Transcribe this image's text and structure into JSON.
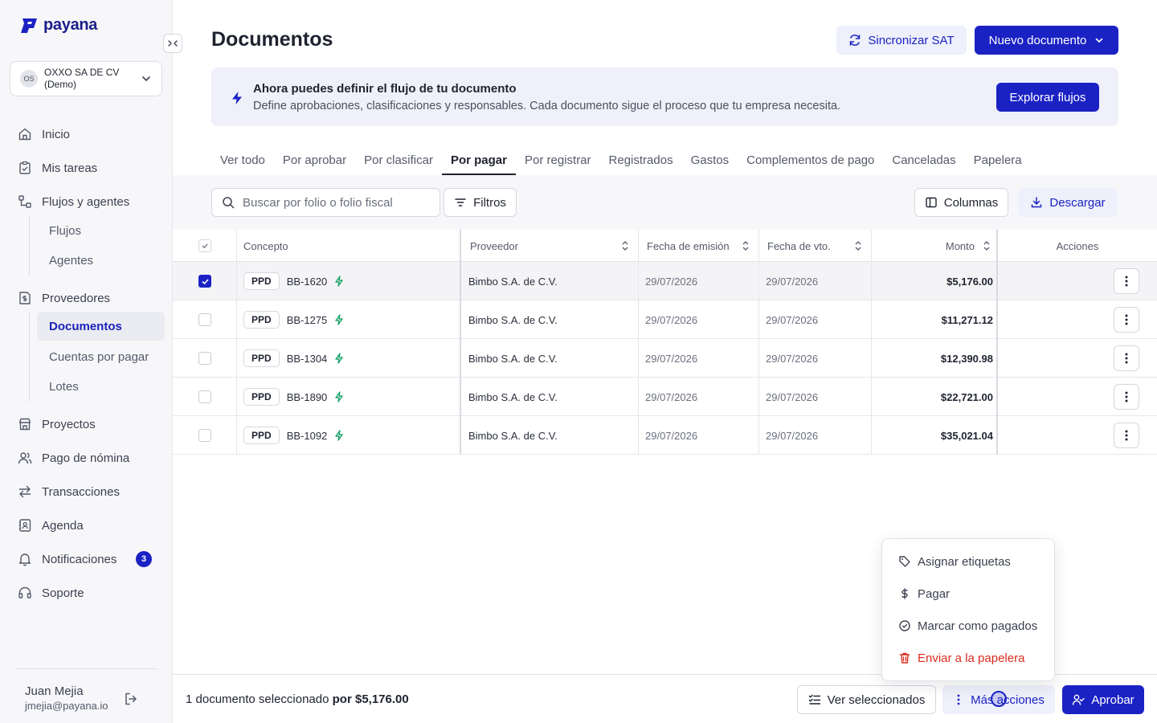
{
  "brand": {
    "name": "payana",
    "accent": "#1b22c4",
    "success": "#1aa36a",
    "danger": "#d92d20"
  },
  "company": {
    "initials": "OS",
    "name": "OXXO SA DE CV (Demo)"
  },
  "nav": {
    "inicio": "Inicio",
    "tareas": "Mis tareas",
    "flujos_agentes": "Flujos y agentes",
    "flujos": "Flujos",
    "agentes": "Agentes",
    "proveedores": "Proveedores",
    "documentos": "Documentos",
    "cuentas": "Cuentas por pagar",
    "lotes": "Lotes",
    "proyectos": "Proyectos",
    "nomina": "Pago de nómina",
    "transacciones": "Transacciones",
    "agenda": "Agenda",
    "notificaciones": "Notificaciones",
    "notificaciones_count": "3",
    "soporte": "Soporte"
  },
  "user": {
    "name": "Juan Mejia",
    "email": "jmejia@payana.io"
  },
  "page": {
    "title": "Documentos",
    "sync_label": "Sincronizar SAT",
    "new_label": "Nuevo documento"
  },
  "banner": {
    "title": "Ahora puedes definir el flujo de tu documento",
    "text": "Define aprobaciones, clasificaciones y responsables. Cada documento sigue el proceso que tu empresa necesita.",
    "button": "Explorar flujos"
  },
  "tabs": [
    "Ver todo",
    "Por aprobar",
    "Por clasificar",
    "Por pagar",
    "Por registrar",
    "Registrados",
    "Gastos",
    "Complementos de pago",
    "Canceladas",
    "Papelera"
  ],
  "active_tab": "Por pagar",
  "toolbar": {
    "search_placeholder": "Buscar por folio o folio fiscal",
    "filters": "Filtros",
    "columns": "Columnas",
    "download": "Descargar"
  },
  "table": {
    "headers": {
      "concepto": "Concepto",
      "proveedor": "Proveedor",
      "emision": "Fecha de emisión",
      "vto": "Fecha de vto.",
      "monto": "Monto",
      "acciones": "Acciones"
    },
    "rows": [
      {
        "tag": "PPD",
        "folio": "BB-1620",
        "proveedor": "Bimbo S.A. de C.V.",
        "emision": "29/07/2026",
        "vto": "29/07/2026",
        "monto": "$5,176.00",
        "selected": true
      },
      {
        "tag": "PPD",
        "folio": "BB-1275",
        "proveedor": "Bimbo S.A. de C.V.",
        "emision": "29/07/2026",
        "vto": "29/07/2026",
        "monto": "$11,271.12",
        "selected": false
      },
      {
        "tag": "PPD",
        "folio": "BB-1304",
        "proveedor": "Bimbo S.A. de C.V.",
        "emision": "29/07/2026",
        "vto": "29/07/2026",
        "monto": "$12,390.98",
        "selected": false
      },
      {
        "tag": "PPD",
        "folio": "BB-1890",
        "proveedor": "Bimbo S.A. de C.V.",
        "emision": "29/07/2026",
        "vto": "29/07/2026",
        "monto": "$22,721.00",
        "selected": false
      },
      {
        "tag": "PPD",
        "folio": "BB-1092",
        "proveedor": "Bimbo S.A. de C.V.",
        "emision": "29/07/2026",
        "vto": "29/07/2026",
        "monto": "$35,021.04",
        "selected": false
      }
    ]
  },
  "menu": {
    "etiquetas": "Asignar etiquetas",
    "pagar": "Pagar",
    "marcar": "Marcar como pagados",
    "papelera": "Enviar a la papelera"
  },
  "bottom": {
    "selection_text": "1 documento seleccionado",
    "selection_prefix": "por",
    "selection_amount": "$5,176.00",
    "view_selected": "Ver seleccionados",
    "more_actions": "Más acciones",
    "approve": "Aprobar"
  }
}
